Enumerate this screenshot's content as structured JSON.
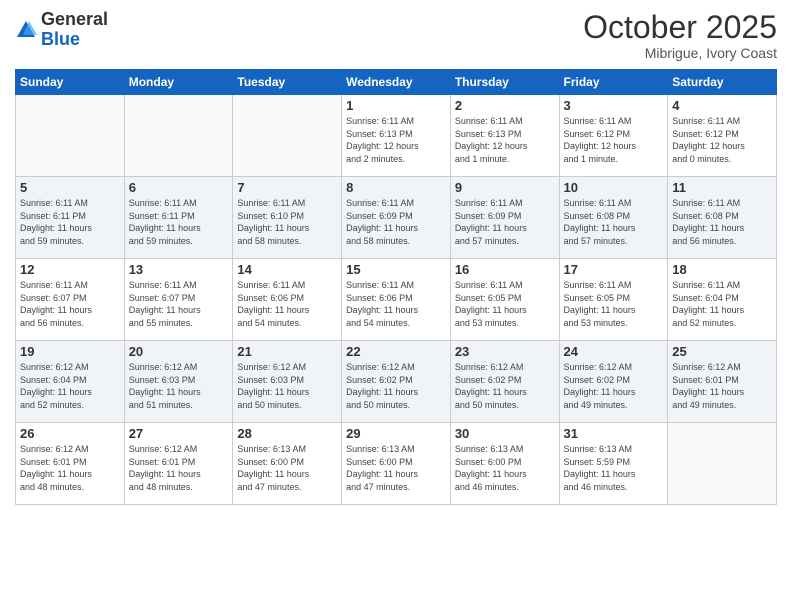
{
  "logo": {
    "general": "General",
    "blue": "Blue"
  },
  "header": {
    "month": "October 2025",
    "location": "Mibrigue, Ivory Coast"
  },
  "weekdays": [
    "Sunday",
    "Monday",
    "Tuesday",
    "Wednesday",
    "Thursday",
    "Friday",
    "Saturday"
  ],
  "weeks": [
    [
      {
        "day": "",
        "info": ""
      },
      {
        "day": "",
        "info": ""
      },
      {
        "day": "",
        "info": ""
      },
      {
        "day": "1",
        "info": "Sunrise: 6:11 AM\nSunset: 6:13 PM\nDaylight: 12 hours\nand 2 minutes."
      },
      {
        "day": "2",
        "info": "Sunrise: 6:11 AM\nSunset: 6:13 PM\nDaylight: 12 hours\nand 1 minute."
      },
      {
        "day": "3",
        "info": "Sunrise: 6:11 AM\nSunset: 6:12 PM\nDaylight: 12 hours\nand 1 minute."
      },
      {
        "day": "4",
        "info": "Sunrise: 6:11 AM\nSunset: 6:12 PM\nDaylight: 12 hours\nand 0 minutes."
      }
    ],
    [
      {
        "day": "5",
        "info": "Sunrise: 6:11 AM\nSunset: 6:11 PM\nDaylight: 11 hours\nand 59 minutes."
      },
      {
        "day": "6",
        "info": "Sunrise: 6:11 AM\nSunset: 6:11 PM\nDaylight: 11 hours\nand 59 minutes."
      },
      {
        "day": "7",
        "info": "Sunrise: 6:11 AM\nSunset: 6:10 PM\nDaylight: 11 hours\nand 58 minutes."
      },
      {
        "day": "8",
        "info": "Sunrise: 6:11 AM\nSunset: 6:09 PM\nDaylight: 11 hours\nand 58 minutes."
      },
      {
        "day": "9",
        "info": "Sunrise: 6:11 AM\nSunset: 6:09 PM\nDaylight: 11 hours\nand 57 minutes."
      },
      {
        "day": "10",
        "info": "Sunrise: 6:11 AM\nSunset: 6:08 PM\nDaylight: 11 hours\nand 57 minutes."
      },
      {
        "day": "11",
        "info": "Sunrise: 6:11 AM\nSunset: 6:08 PM\nDaylight: 11 hours\nand 56 minutes."
      }
    ],
    [
      {
        "day": "12",
        "info": "Sunrise: 6:11 AM\nSunset: 6:07 PM\nDaylight: 11 hours\nand 56 minutes."
      },
      {
        "day": "13",
        "info": "Sunrise: 6:11 AM\nSunset: 6:07 PM\nDaylight: 11 hours\nand 55 minutes."
      },
      {
        "day": "14",
        "info": "Sunrise: 6:11 AM\nSunset: 6:06 PM\nDaylight: 11 hours\nand 54 minutes."
      },
      {
        "day": "15",
        "info": "Sunrise: 6:11 AM\nSunset: 6:06 PM\nDaylight: 11 hours\nand 54 minutes."
      },
      {
        "day": "16",
        "info": "Sunrise: 6:11 AM\nSunset: 6:05 PM\nDaylight: 11 hours\nand 53 minutes."
      },
      {
        "day": "17",
        "info": "Sunrise: 6:11 AM\nSunset: 6:05 PM\nDaylight: 11 hours\nand 53 minutes."
      },
      {
        "day": "18",
        "info": "Sunrise: 6:11 AM\nSunset: 6:04 PM\nDaylight: 11 hours\nand 52 minutes."
      }
    ],
    [
      {
        "day": "19",
        "info": "Sunrise: 6:12 AM\nSunset: 6:04 PM\nDaylight: 11 hours\nand 52 minutes."
      },
      {
        "day": "20",
        "info": "Sunrise: 6:12 AM\nSunset: 6:03 PM\nDaylight: 11 hours\nand 51 minutes."
      },
      {
        "day": "21",
        "info": "Sunrise: 6:12 AM\nSunset: 6:03 PM\nDaylight: 11 hours\nand 50 minutes."
      },
      {
        "day": "22",
        "info": "Sunrise: 6:12 AM\nSunset: 6:02 PM\nDaylight: 11 hours\nand 50 minutes."
      },
      {
        "day": "23",
        "info": "Sunrise: 6:12 AM\nSunset: 6:02 PM\nDaylight: 11 hours\nand 50 minutes."
      },
      {
        "day": "24",
        "info": "Sunrise: 6:12 AM\nSunset: 6:02 PM\nDaylight: 11 hours\nand 49 minutes."
      },
      {
        "day": "25",
        "info": "Sunrise: 6:12 AM\nSunset: 6:01 PM\nDaylight: 11 hours\nand 49 minutes."
      }
    ],
    [
      {
        "day": "26",
        "info": "Sunrise: 6:12 AM\nSunset: 6:01 PM\nDaylight: 11 hours\nand 48 minutes."
      },
      {
        "day": "27",
        "info": "Sunrise: 6:12 AM\nSunset: 6:01 PM\nDaylight: 11 hours\nand 48 minutes."
      },
      {
        "day": "28",
        "info": "Sunrise: 6:13 AM\nSunset: 6:00 PM\nDaylight: 11 hours\nand 47 minutes."
      },
      {
        "day": "29",
        "info": "Sunrise: 6:13 AM\nSunset: 6:00 PM\nDaylight: 11 hours\nand 47 minutes."
      },
      {
        "day": "30",
        "info": "Sunrise: 6:13 AM\nSunset: 6:00 PM\nDaylight: 11 hours\nand 46 minutes."
      },
      {
        "day": "31",
        "info": "Sunrise: 6:13 AM\nSunset: 5:59 PM\nDaylight: 11 hours\nand 46 minutes."
      },
      {
        "day": "",
        "info": ""
      }
    ]
  ]
}
